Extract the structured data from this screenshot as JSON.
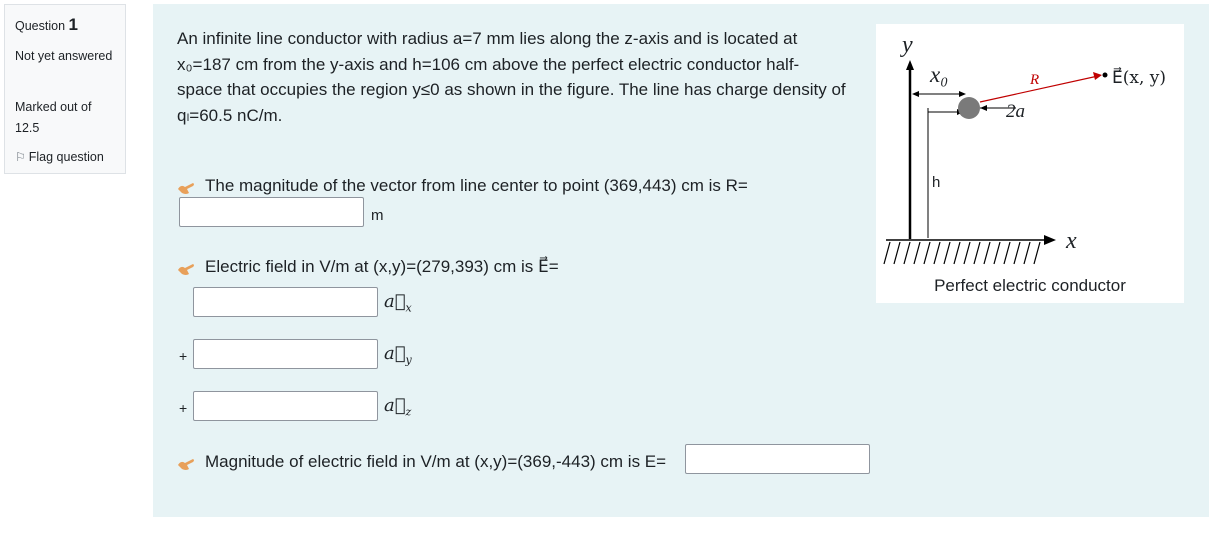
{
  "info": {
    "question_label": "Question",
    "question_number": "1",
    "state": "Not yet answered",
    "grade": "Marked out of 12.5",
    "flag_label": "Flag question"
  },
  "question": {
    "line1": "An infinite line conductor with radius a=7 mm lies along the z-axis and is located at",
    "line2": "x₀=187 cm from the y-axis and h=106 cm above the perfect electric conductor half-",
    "line3": "space that occupies the region y≤0 as shown in the figure. The line has charge density of",
    "line4": "qₗ=60.5 nC/m."
  },
  "figure": {
    "y_label": "y",
    "x0_label": "x₀",
    "R_label": "R⃗",
    "E_label": "E⃗(x, y)",
    "a_label": "2a",
    "h_label": "h",
    "x_label": "x",
    "caption": "Perfect electric conductor"
  },
  "parts": {
    "p1_text": "The magnitude of the vector from line center to point (369,443) cm is R=",
    "p1_unit": "m",
    "p2_text": "Electric field in V/m at (x,y)=(279,393) cm is E⃗=",
    "ax": "a⃗",
    "ax_sub": "x",
    "ay": "a⃗",
    "ay_sub": "y",
    "az": "a⃗",
    "az_sub": "z",
    "plus": "+",
    "p3_text": "Magnitude of electric field in V/m at (x,y)=(369,-443) cm is E="
  }
}
